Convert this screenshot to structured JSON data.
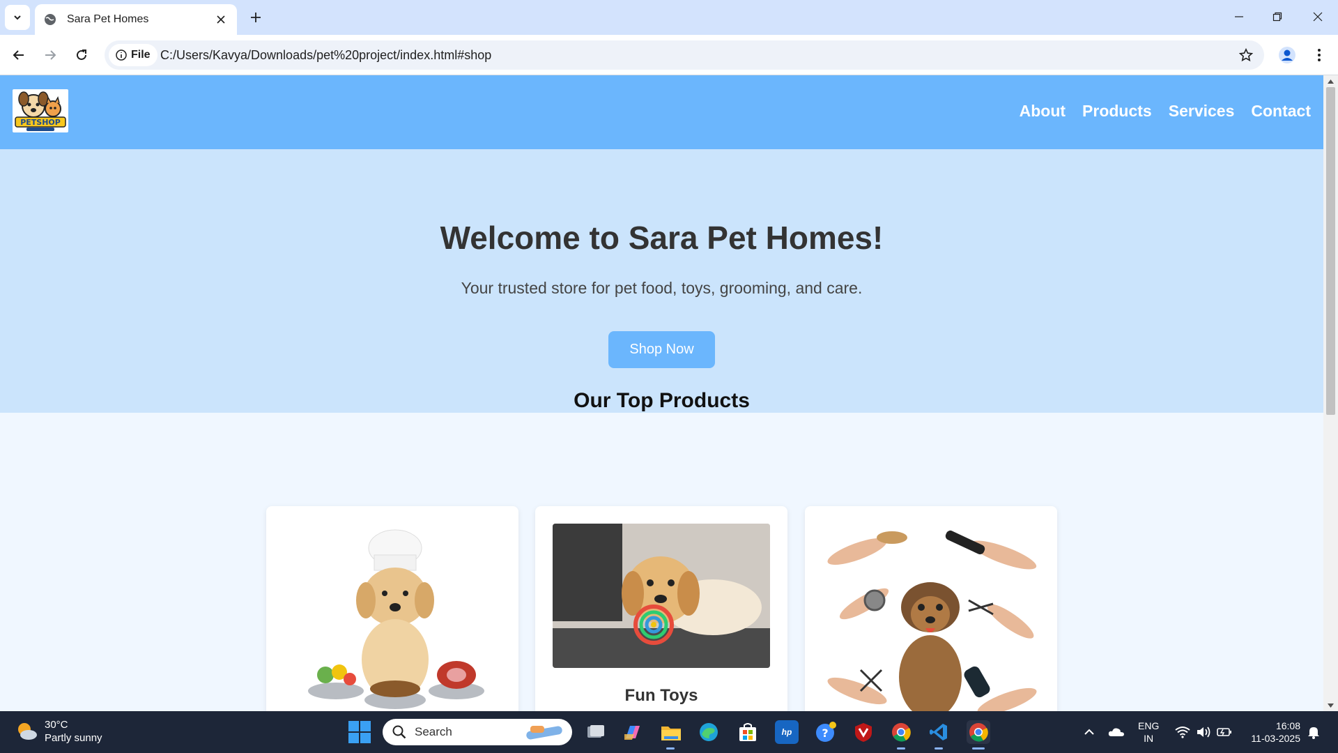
{
  "browser": {
    "tab_title": "Sara Pet Homes",
    "site_chip": "File",
    "url": "C:/Users/Kavya/Downloads/pet%20project/index.html#shop"
  },
  "site": {
    "nav": [
      "About",
      "Products",
      "Services",
      "Contact"
    ],
    "hero_title": "Welcome to Sara Pet Homes!",
    "hero_subtitle": "Your trusted store for pet food, toys, grooming, and care.",
    "cta_label": "Shop Now",
    "products_title": "Our Top Products",
    "products": [
      {
        "title": "",
        "image": "puppy-chef-food-image"
      },
      {
        "title": "Fun Toys",
        "image": "puppy-with-toy-image"
      },
      {
        "title": "",
        "image": "dog-grooming-image"
      }
    ],
    "logo_text": "PETSHOP"
  },
  "taskbar": {
    "temp": "30°C",
    "condition": "Partly sunny",
    "search_label": "Search",
    "lang_top": "ENG",
    "lang_bottom": "IN",
    "time": "16:08",
    "date": "11-03-2025"
  },
  "colors": {
    "header": "#6bb6fd",
    "hero": "#cbe4fc",
    "page_bg": "#f0f7ff",
    "taskbar": "#1d2638"
  }
}
